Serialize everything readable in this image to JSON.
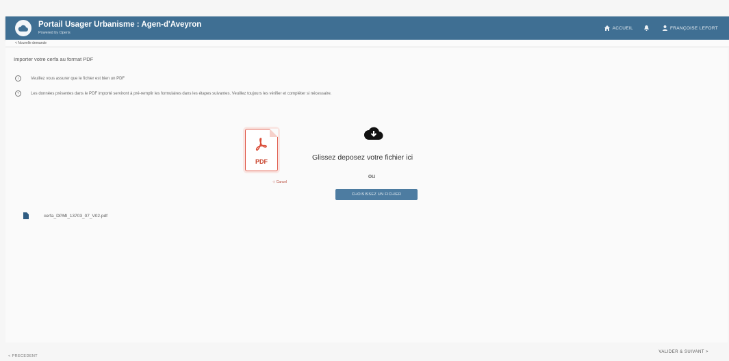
{
  "header": {
    "title": "Portail Usager Urbanisme : Agen-d'Aveyron",
    "subtitle": "Powered by Operis",
    "nav": [
      {
        "label": "ACCUEIL",
        "icon": "home-icon"
      },
      {
        "label": "",
        "icon": "bell-icon"
      },
      {
        "label": "FRANÇOISE LEFORT",
        "icon": "user-icon"
      }
    ]
  },
  "subbar": {
    "label": "< Nouvelle demande"
  },
  "main": {
    "heading": "Importer votre cerfa au format PDF",
    "info": [
      "Veuillez vous assurer que le fichier est bien un PDF",
      "Les données présentes dans le PDF importé serviront à pré-remplir les formulaires dans les étapes suivantes. Veuillez toujours les vérifier et compléter si nécessaire."
    ],
    "pdf_label": "PDF",
    "cancel_label": "Cancel",
    "drop_text": "Glissez deposez votre fichier ici",
    "or_text": "ou",
    "choose_button": "CHOISISSEZ UN FICHIER",
    "file_name": "cerfa_DPMI_13703_07_V02.pdf"
  },
  "footer": {
    "previous": "< PRECEDENT",
    "next": "VALIDER & SUIVANT >"
  },
  "colors": {
    "header_bg": "#3f6f93",
    "button_bg": "#4d7ca1",
    "pdf_red": "#c9452f"
  }
}
